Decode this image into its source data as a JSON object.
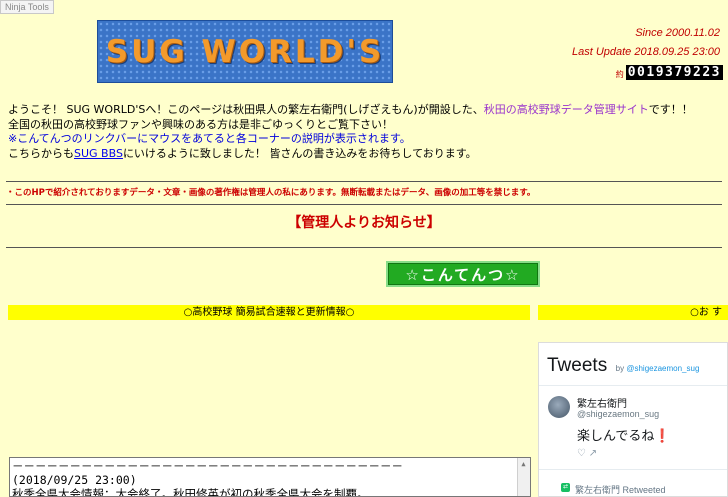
{
  "ninja_tools": "Ninja Tools",
  "logo_text": "SUG WORLD'S",
  "since": "Since 2000.11.02",
  "last_update": "Last Update 2018.09.25 23:00",
  "counter_prefix": "約",
  "counter": "0019379223",
  "intro": {
    "line1_pre": "ようこそ！ SUG WORLD'Sへ！このページは秋田県人の繁左右衛門(しげざえもん)が開設した、",
    "line1_link": "秋田の高校野球データ管理サイト",
    "line1_post": "です！！",
    "line2": "全国の秋田の高校野球ファンや興味のある方は是非ごゆっくりとご覧下さい！",
    "line3": "※こんてんつのリンクバーにマウスをあてると各コーナーの説明が表示されます。",
    "line4_pre": "こちらからも",
    "line4_link": "SUG BBS",
    "line4_post": "にいけるように致しました！ 皆さんの書き込みをお待ちしております。"
  },
  "copyright": "・このHPで紹介されておりますデータ・文章・画像の著作権は管理人の私にあります。無断転載またはデータ、画像の加工等を禁じます。",
  "notice_heading": "【管理人よりお知らせ】",
  "contents_button": "☆こんてんつ☆",
  "band_left": "○高校野球 簡易試合速報と更新情報○",
  "band_right": "○お す",
  "tweets": {
    "title": "Tweets",
    "by": "by",
    "handle": "@shigezaemon_sug",
    "author_name": "繁左右衛門",
    "author_handle": "@shigezaemon_sug",
    "text": "楽しんでるね",
    "exclaim": "❗",
    "retweet_line": "繁左右衛門 Retweeted",
    "icons": "♡  ↗"
  },
  "news": {
    "line1": "－－－－－－－－－－－－－－－－－－－－－－－－－－－－－－－－－－",
    "line2": "(2018/09/25 23:00)",
    "line3": "秋季全県大会情報：大会終了。秋田修英が初の秋季全県大会を制覇。"
  }
}
